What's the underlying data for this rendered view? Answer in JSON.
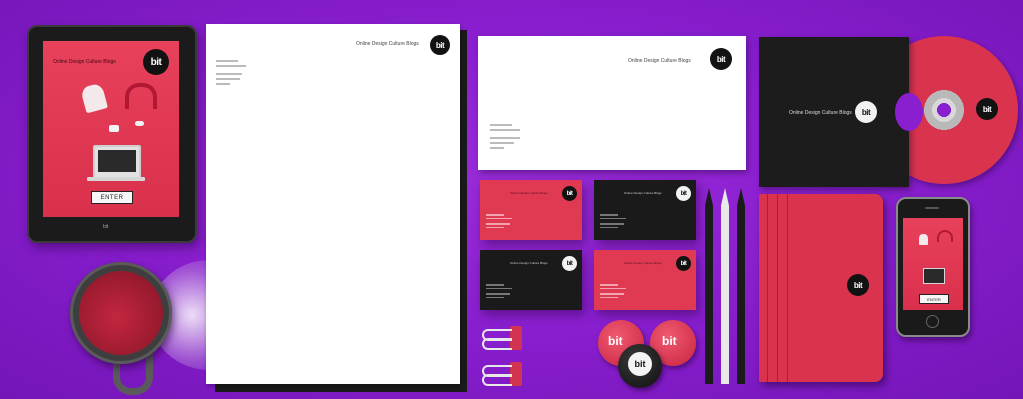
{
  "brand": {
    "logo_text": "bit",
    "tagline": "Online Design Culture Blogs",
    "accent_color": "#e03a53",
    "dark_color": "#161616",
    "background_color": "#8a1fd0"
  },
  "tablet": {
    "headline": "Online Design Culture Blogs",
    "button_label": "ENTER",
    "footer_mark": "bit"
  },
  "phone": {
    "button_label": "ENTER"
  },
  "letterhead": {
    "header_text": "Online Design Culture Blogs"
  },
  "envelope": {
    "header_text": "Online Design Culture Blogs"
  },
  "folder": {
    "label_text": "Online Design Culture Blogs"
  },
  "business_cards": {
    "header_text": "Online Design Culture Blogs"
  },
  "badges": {
    "logo_text": "bit"
  }
}
